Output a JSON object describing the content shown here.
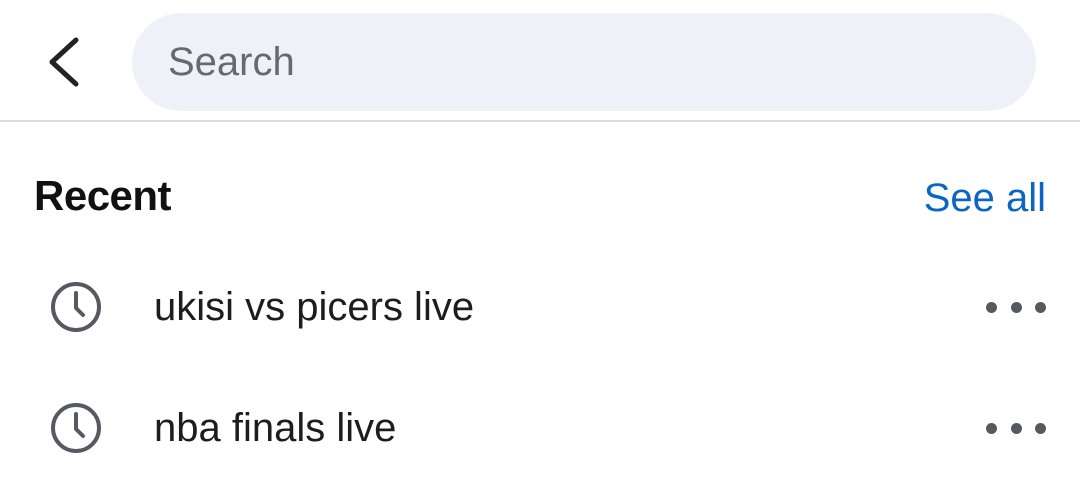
{
  "search": {
    "placeholder": "Search",
    "value": ""
  },
  "recent": {
    "title": "Recent",
    "see_all_label": "See all",
    "items": [
      {
        "label": "ukisi vs picers live",
        "icon": "clock-icon"
      },
      {
        "label": "nba finals live",
        "icon": "clock-icon"
      }
    ]
  },
  "colors": {
    "accent": "#0a66c2",
    "search_bg": "#eef1f7",
    "icon": "#555a60"
  }
}
